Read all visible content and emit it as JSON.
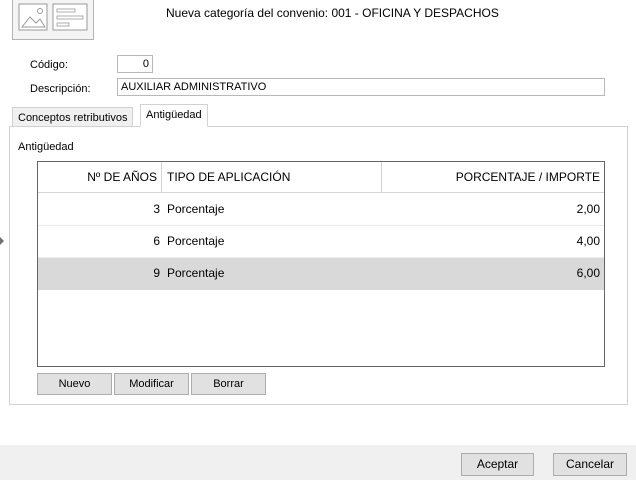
{
  "header": {
    "title": "Nueva categoría del convenio: 001 - OFICINA Y DESPACHOS"
  },
  "form": {
    "codigo_label": "Código:",
    "codigo_value": "0",
    "descripcion_label": "Descripción:",
    "descripcion_value": "AUXILIAR ADMINISTRATIVO"
  },
  "tabs": [
    {
      "label": "Conceptos retributivos",
      "active": false
    },
    {
      "label": "Antigüedad",
      "active": true
    }
  ],
  "panel": {
    "group_title": "Antigüedad"
  },
  "grid": {
    "columns": [
      "Nº DE AÑOS",
      "TIPO DE APLICACIÓN",
      "PORCENTAJE / IMPORTE"
    ],
    "rows": [
      {
        "years": "3",
        "type": "Porcentaje",
        "amount": "2,00",
        "selected": false
      },
      {
        "years": "6",
        "type": "Porcentaje",
        "amount": "4,00",
        "selected": false
      },
      {
        "years": "9",
        "type": "Porcentaje",
        "amount": "6,00",
        "selected": true
      }
    ]
  },
  "grid_buttons": {
    "new_label": "Nuevo",
    "edit_label": "Modificar",
    "delete_label": "Borrar"
  },
  "footer": {
    "accept_label": "Aceptar",
    "cancel_label": "Cancelar"
  },
  "colors": {
    "selected_row": "#d9d9d9",
    "grid_border": "#646464",
    "footer_bg": "#f0f0f0"
  }
}
